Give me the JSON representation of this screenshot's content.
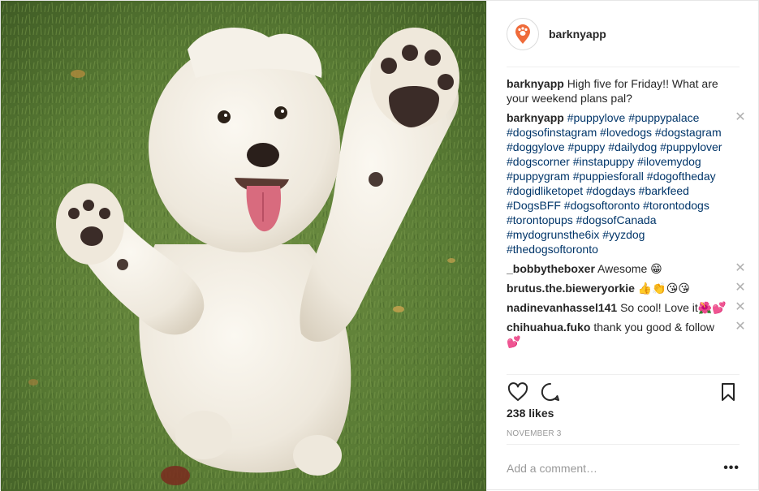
{
  "account": {
    "username": "barknyapp",
    "avatar_icon": "barkny-paw-pin-logo",
    "brand_color": "#ef6b3a"
  },
  "comments": [
    {
      "user": "barknyapp",
      "text": "High five for Friday!! What are your weekend plans pal?",
      "kind": "caption"
    },
    {
      "user": "barknyapp",
      "text": "#puppylove #puppypalace #dogsofinstagram #lovedogs #dogstagram #doggylove #puppy #dailydog #puppylover #dogscorner #instapuppy #ilovemydog #puppygram #puppiesforall #dogoftheday #dogidliketopet #dogdays #barkfeed #DogsBFF #dogsoftoronto #torontodogs #torontopups #dogsofCanada #mydogrunsthe6ix #yyzdog #thedogsoftoronto",
      "kind": "hashtags"
    },
    {
      "user": "_bobbytheboxer",
      "text": "Awesome 😁"
    },
    {
      "user": "brutus.the.bieweryorkie",
      "text": "👍👏😘😘"
    },
    {
      "user": "nadinevanhassel141",
      "text": "So cool! Love it🌺💕"
    },
    {
      "user": "chihuahua.fuko",
      "text": "thank you good & follow💕"
    }
  ],
  "actions": {
    "like_icon": "heart-outline-icon",
    "comment_icon": "speech-bubble-icon",
    "save_icon": "bookmark-icon"
  },
  "likes": "238 likes",
  "date": "NOVEMBER 3",
  "add_comment": {
    "placeholder": "Add a comment…",
    "more_label": "•••"
  }
}
